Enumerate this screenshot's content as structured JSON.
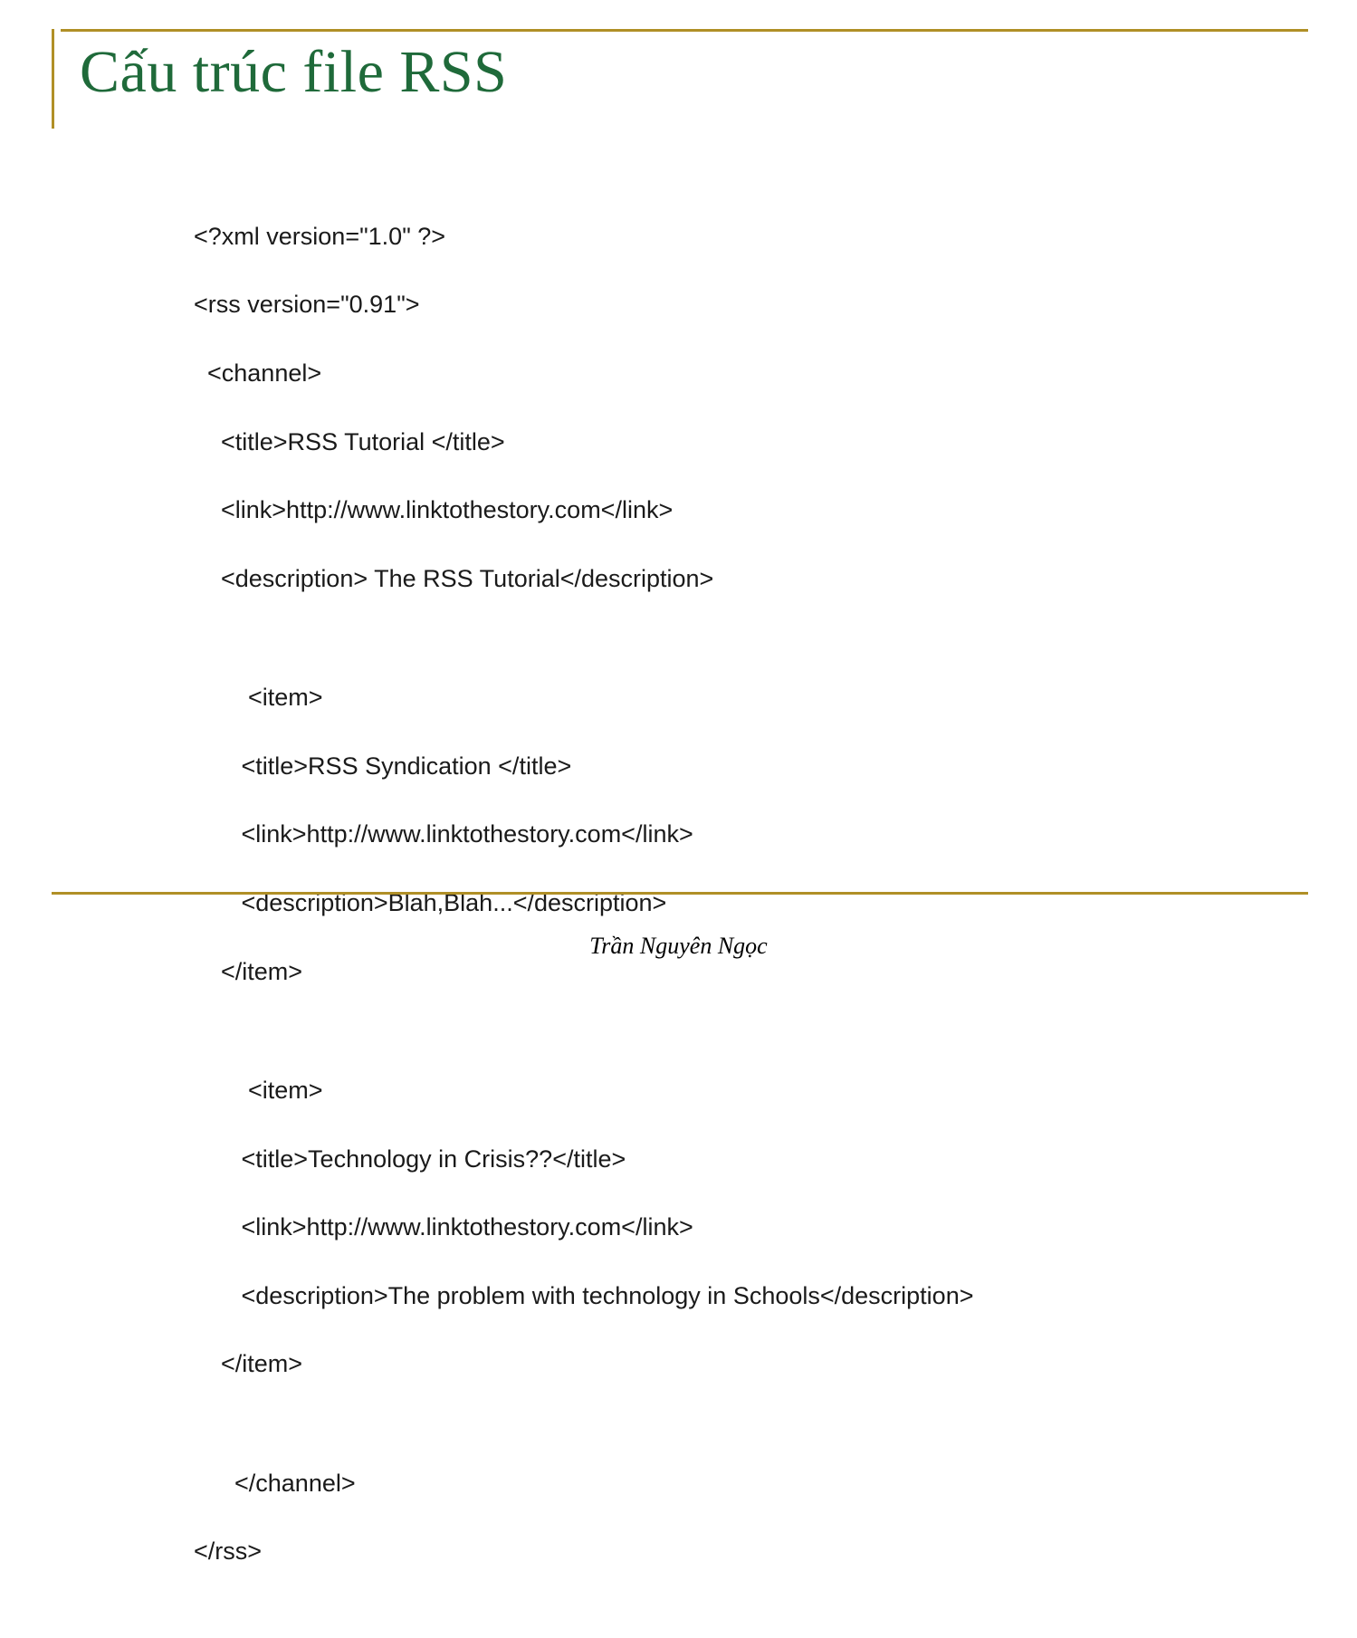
{
  "title": "Cấu trúc file RSS",
  "code": {
    "l1": "<?xml version=\"1.0\" ?>",
    "l2": "<rss version=\"0.91\">",
    "l3": "  <channel>",
    "l4": "    <title>RSS Tutorial </title>",
    "l5": "    <link>http://www.linktothestory.com</link>",
    "l6": "    <description> The RSS Tutorial</description>",
    "l7": "        <item>",
    "l8": "       <title>RSS Syndication </title>",
    "l9": "       <link>http://www.linktothestory.com</link>",
    "l10": "       <description>Blah,Blah...</description>",
    "l11": "    </item>",
    "l12": "        <item>",
    "l13": "       <title>Technology in Crisis??</title>",
    "l14": "       <link>http://www.linktothestory.com</link>",
    "l15": "       <description>The problem with technology in Schools</description>",
    "l16": "    </item>",
    "l17": "      </channel>",
    "l18": "</rss>"
  },
  "footer": "Trần Nguyên Ngọc"
}
